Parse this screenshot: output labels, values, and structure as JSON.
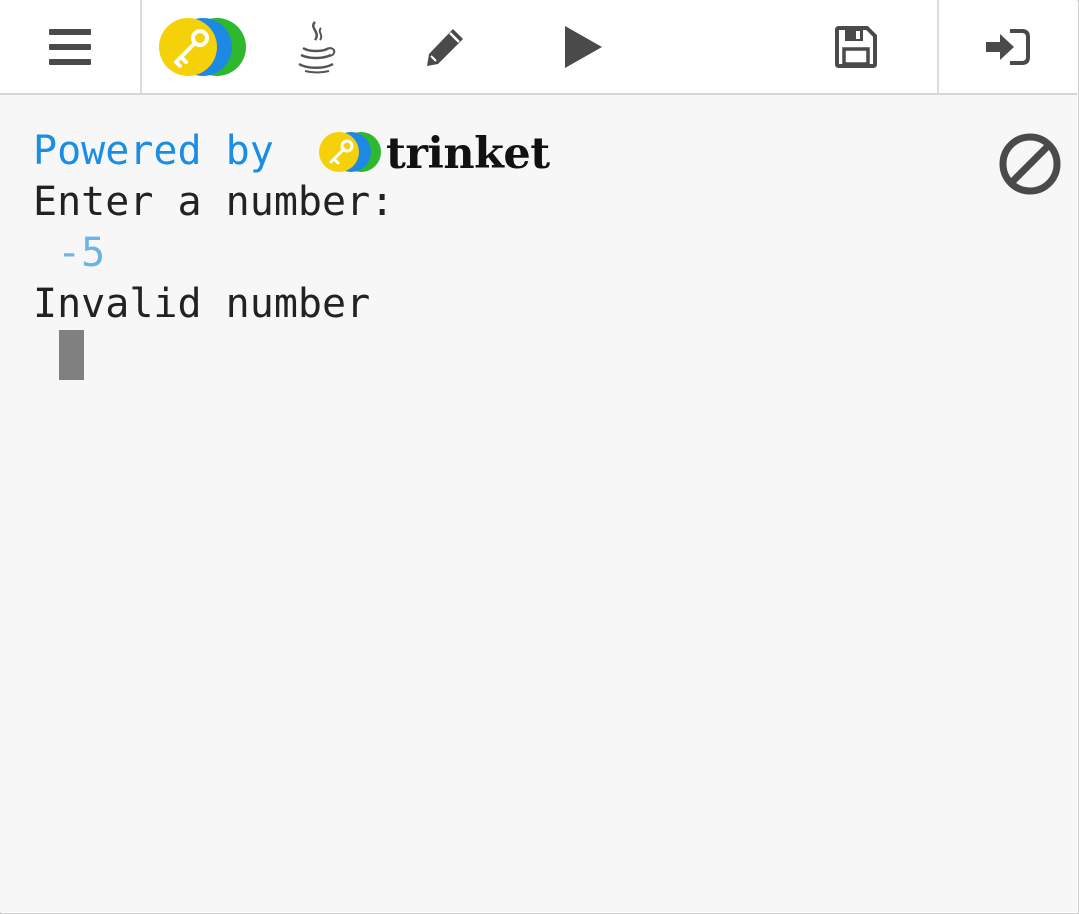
{
  "toolbar": {
    "menu_icon": "hamburger-menu-icon",
    "logo_icon": "trinket-key-logo",
    "language_icon": "java-coffee-cup-icon",
    "edit_icon": "pencil-icon",
    "run_icon": "play-icon",
    "save_icon": "floppy-disk-icon",
    "login_icon": "sign-in-icon"
  },
  "console": {
    "powered_by": "Powered by",
    "brand": "trinket",
    "lines": [
      {
        "text": "Enter a number:",
        "kind": "output"
      },
      {
        "text": " -5",
        "kind": "input"
      },
      {
        "text": "Invalid number",
        "kind": "output"
      }
    ],
    "clear_icon": "clear-ban-icon"
  },
  "colors": {
    "powered_by": "#1a8ee5",
    "input_echo": "#6ab4ec",
    "logo_yellow": "#f5d10a",
    "logo_blue": "#1e88e5",
    "logo_green": "#2eb82e",
    "icon_gray": "#4a4a4a"
  }
}
